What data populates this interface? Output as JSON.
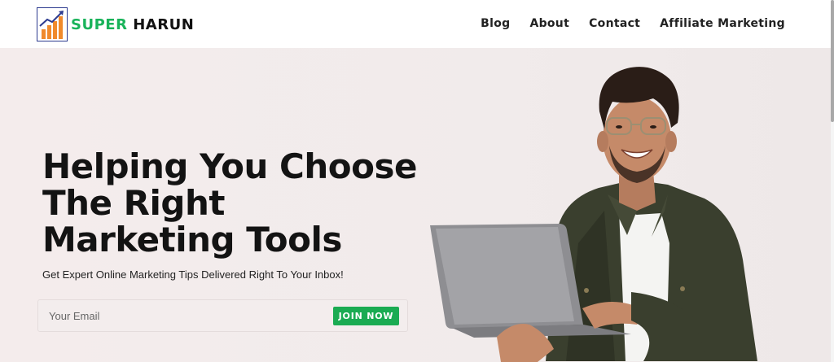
{
  "header": {
    "logo": {
      "super": "SUPER",
      "harun": "HARUN",
      "icon": "bar-chart-growth-icon"
    },
    "nav": [
      {
        "label": "Blog"
      },
      {
        "label": "About"
      },
      {
        "label": "Contact"
      },
      {
        "label": "Affiliate Marketing"
      }
    ]
  },
  "hero": {
    "headline_line1": "Helping You Choose",
    "headline_line2": "The Right",
    "headline_line3": "Marketing Tools",
    "subtitle": "Get Expert Online Marketing Tips Delivered Right To Your Inbox!",
    "email_placeholder": "Your Email",
    "join_label": "JOIN NOW"
  },
  "colors": {
    "brand_green": "#19b35a",
    "button_green": "#1aab52",
    "hero_bg": "#f2ebeb",
    "text_dark": "#131313"
  }
}
